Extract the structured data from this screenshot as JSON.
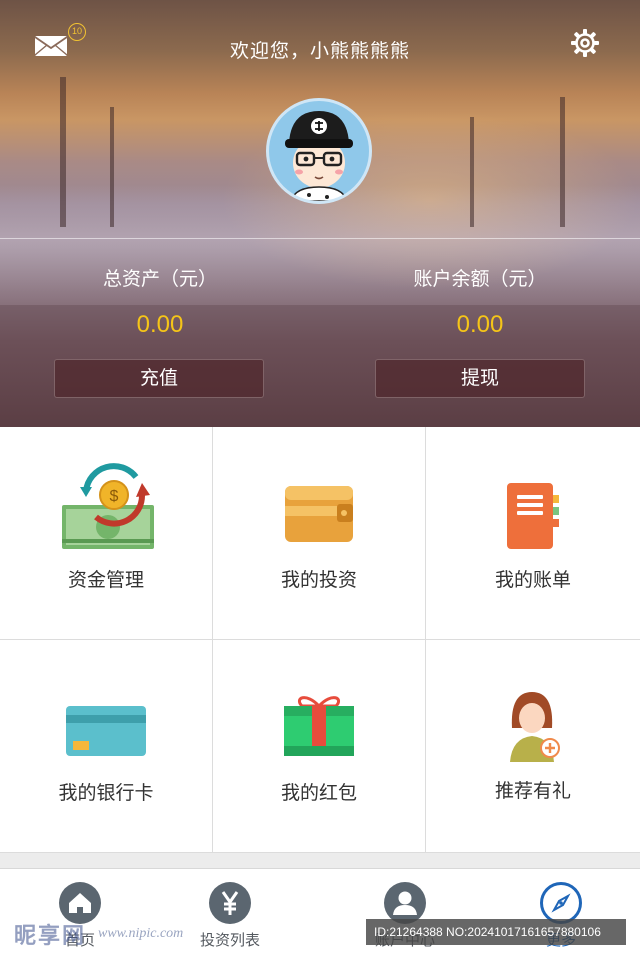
{
  "header": {
    "welcome_text": "欢迎您，小熊熊熊熊",
    "mail_icon": "mail-icon",
    "mail_badge_count": "10",
    "settings_icon": "gear-icon",
    "avatar_icon": "user-avatar"
  },
  "assets": {
    "total_label": "总资产（元）",
    "total_value": "0.00",
    "balance_label": "账户余额（元）",
    "balance_value": "0.00",
    "recharge_label": "充值",
    "withdraw_label": "提现"
  },
  "menu": {
    "items": [
      {
        "label": "资金管理",
        "icon": "money-exchange-icon"
      },
      {
        "label": "我的投资",
        "icon": "wallet-icon"
      },
      {
        "label": "我的账单",
        "icon": "notebook-icon"
      },
      {
        "label": "我的银行卡",
        "icon": "bank-card-icon"
      },
      {
        "label": "我的红包",
        "icon": "gift-icon"
      },
      {
        "label": "推荐有礼",
        "icon": "referral-icon"
      }
    ]
  },
  "tabbar": {
    "tabs": [
      {
        "label": "首页",
        "icon": "home-icon",
        "active": false
      },
      {
        "label": "投资列表",
        "icon": "yen-icon",
        "active": false
      },
      {
        "label": "账户中心",
        "icon": "user-icon",
        "active": false
      },
      {
        "label": "更多",
        "icon": "compass-icon",
        "active": true
      }
    ]
  },
  "watermark": {
    "logo_text": "昵享网",
    "url_text": "www.nipic.com",
    "id_text": "ID:21264388 NO:20241017161657880106"
  },
  "colors": {
    "accent_value": "#f5c518",
    "active_tab": "#1f66b8",
    "tab_icon": "#5b6670"
  }
}
